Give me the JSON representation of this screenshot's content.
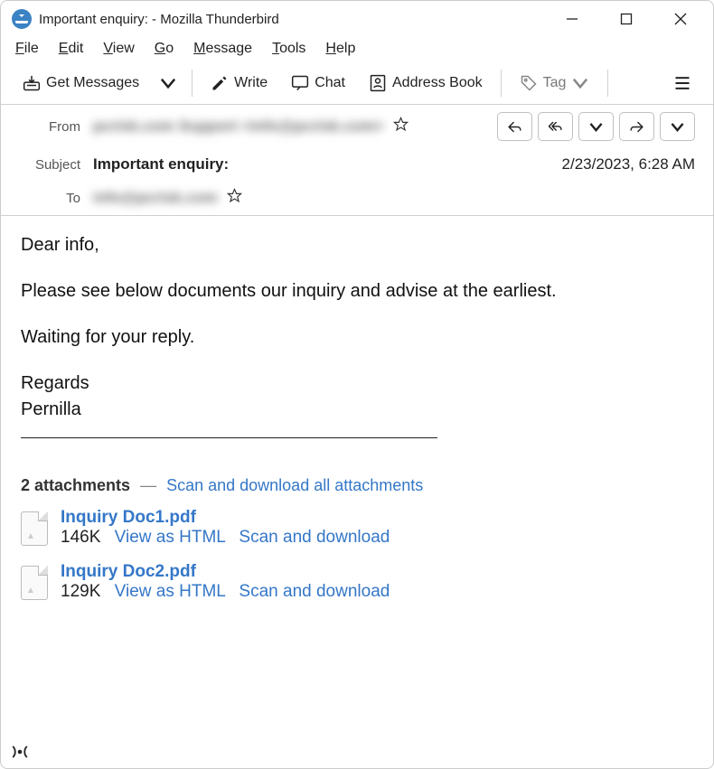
{
  "window": {
    "title": "Important enquiry: - Mozilla Thunderbird"
  },
  "menus": {
    "file": "File",
    "edit": "Edit",
    "view": "View",
    "go": "Go",
    "message": "Message",
    "tools": "Tools",
    "help": "Help"
  },
  "toolbar": {
    "get_messages": "Get Messages",
    "write": "Write",
    "chat": "Chat",
    "address_book": "Address Book",
    "tag": "Tag"
  },
  "headers": {
    "from_label": "From",
    "from_value": "pcrisk.com Support  <info@pcrisk.com>",
    "subject_label": "Subject",
    "subject_value": "Important enquiry:",
    "date": "2/23/2023, 6:28 AM",
    "to_label": "To",
    "to_value": "info@pcrisk.com"
  },
  "body": {
    "greeting": "Dear info,",
    "p1": "Please see below documents our inquiry and advise at the earliest.",
    "p2": "Waiting for your reply.",
    "regards": "Regards",
    "sender": "Pernilla"
  },
  "attachments": {
    "count_label": "2 attachments",
    "all_link": "Scan and download all attachments",
    "view_html": "View as HTML",
    "scan_dl": "Scan and download",
    "items": [
      {
        "name": "Inquiry Doc1.pdf",
        "size": "146K"
      },
      {
        "name": "Inquiry Doc2.pdf",
        "size": "129K"
      }
    ]
  }
}
